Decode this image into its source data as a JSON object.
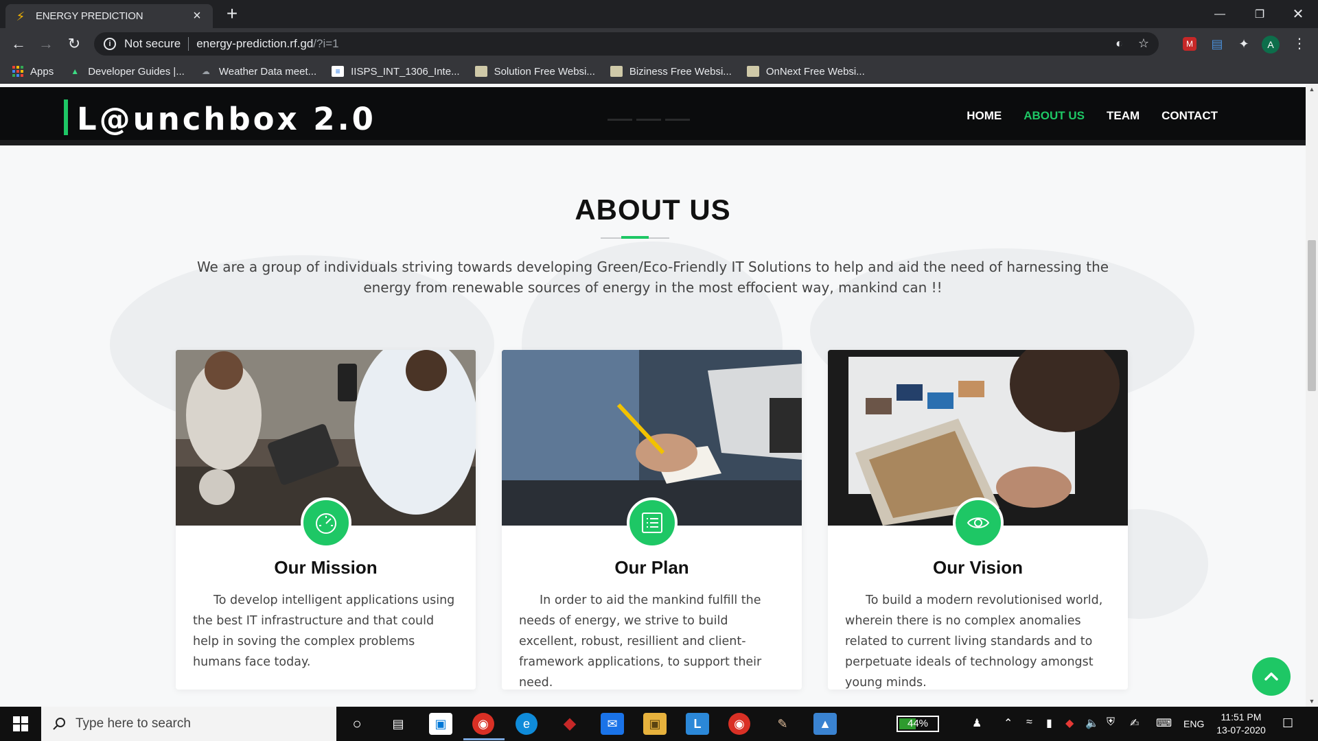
{
  "browser": {
    "tab_title": "ENERGY PREDICTION",
    "security_label": "Not secure",
    "url_host": "energy-prediction.rf.gd",
    "url_path": "/?i=1",
    "profile_initial": "A",
    "bookmarks": [
      {
        "label": "Apps"
      },
      {
        "label": "Developer Guides |..."
      },
      {
        "label": "Weather Data meet..."
      },
      {
        "label": "IISPS_INT_1306_Inte..."
      },
      {
        "label": "Solution Free Websi..."
      },
      {
        "label": "Biziness Free Websi..."
      },
      {
        "label": "OnNext Free Websi..."
      }
    ]
  },
  "site": {
    "logo": "L@unchbox 2.0",
    "nav": [
      {
        "label": "HOME"
      },
      {
        "label": "ABOUT US"
      },
      {
        "label": "TEAM"
      },
      {
        "label": "CONTACT"
      }
    ],
    "active_nav": "ABOUT US",
    "accent_color": "#1ec765"
  },
  "about": {
    "title": "ABOUT US",
    "intro": "We are a group of individuals striving towards developing Green/Eco-Friendly IT Solutions to help and aid the need of harnessing the energy from renewable sources of energy in the most effocient way, mankind can !!",
    "cards": [
      {
        "title": "Our Mission",
        "icon": "speedometer-icon",
        "text": "To develop intelligent applications using the best IT infrastructure and that could help in soving the complex problems humans face today."
      },
      {
        "title": "Our Plan",
        "icon": "list-icon",
        "text": "In order to aid the mankind fulfill the needs of energy, we strive to build excellent, robust, resillient and client-framework applications, to support their need."
      },
      {
        "title": "Our Vision",
        "icon": "eye-icon",
        "text": "To build a modern revolutionised world, wherein there is no complex anomalies related to current living standards and to perpetuate ideals of technology amongst young minds."
      }
    ]
  },
  "taskbar": {
    "search_placeholder": "Type here to search",
    "battery": "44%",
    "battery_level": 0.44,
    "language": "ENG",
    "time": "11:51 PM",
    "date": "13-07-2020"
  }
}
